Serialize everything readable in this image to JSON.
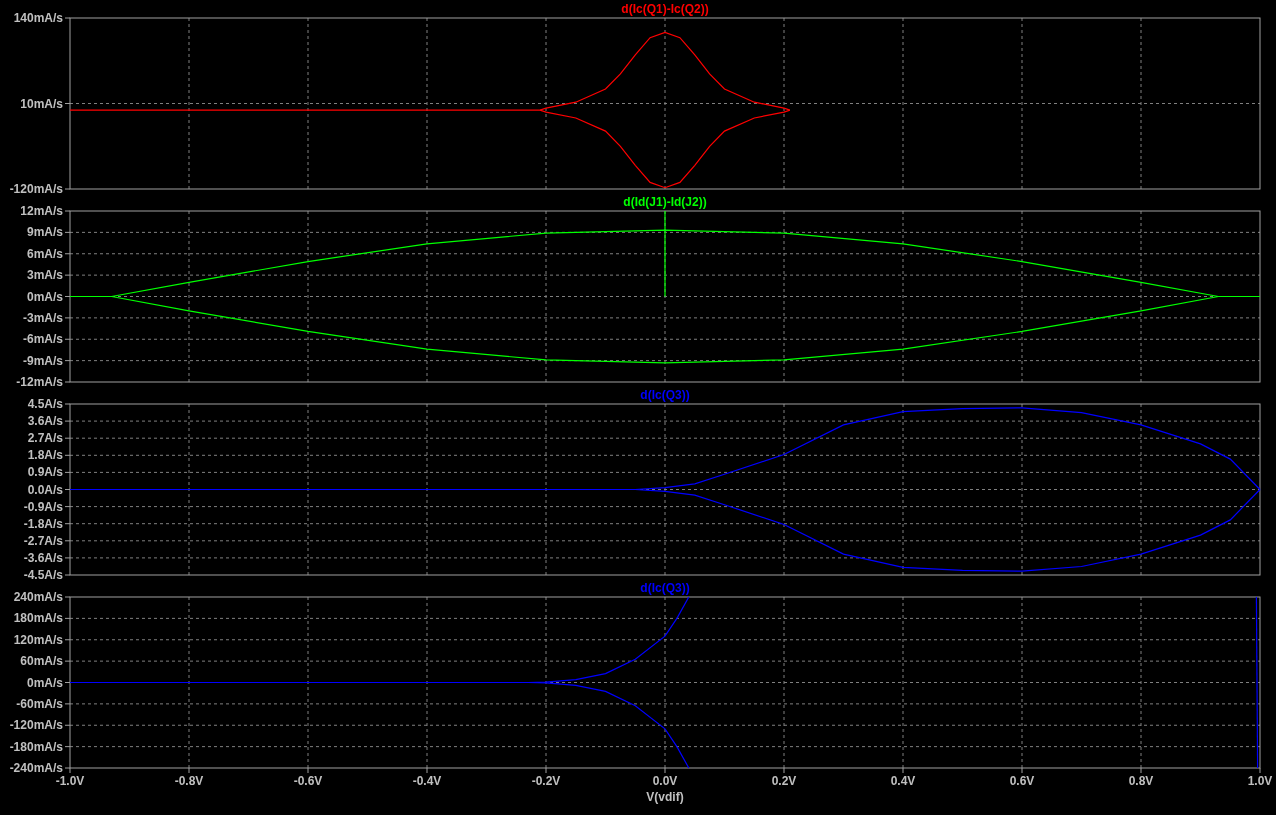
{
  "panes": [
    {
      "chart_data": {
        "type": "line",
        "grid": true,
        "title": "d(Ic(Q1)-Ic(Q2))",
        "xlim": [
          -1,
          1
        ],
        "ylim": [
          -120,
          140
        ],
        "yticks": [
          {
            "value": 140,
            "label": "140mA/s"
          },
          {
            "value": 10,
            "label": "10mA/s"
          },
          {
            "value": -120,
            "label": "-120mA/s"
          }
        ],
        "x": [
          -1,
          -0.5,
          -0.21,
          -0.2,
          -0.15,
          -0.1,
          -0.075,
          -0.05,
          -0.025,
          0,
          0.025,
          0.05,
          0.075,
          0.1,
          0.15,
          0.2,
          0.21
        ],
        "series": [
          {
            "color": "#ff0000",
            "values": [
              0,
              0,
              0,
              3,
              12,
              32,
              55,
              84,
              110,
              118,
              110,
              84,
              55,
              32,
              12,
              3,
              0
            ]
          },
          {
            "color": "#ff0000",
            "values": [
              null,
              null,
              0,
              -3,
              -12,
              -32,
              -55,
              -84,
              -110,
              -118,
              -110,
              -84,
              -55,
              -32,
              -12,
              -3,
              0
            ]
          }
        ]
      }
    },
    {
      "chart_data": {
        "type": "line",
        "grid": true,
        "title": "d(Id(J1)-Id(J2))",
        "xlim": [
          -1,
          1
        ],
        "ylim": [
          -12,
          12
        ],
        "yticks": [
          {
            "value": 12,
            "label": "12mA/s"
          },
          {
            "value": 9,
            "label": "9mA/s"
          },
          {
            "value": 6,
            "label": "6mA/s"
          },
          {
            "value": 3,
            "label": "3mA/s"
          },
          {
            "value": 0,
            "label": "0mA/s"
          },
          {
            "value": -3,
            "label": "-3mA/s"
          },
          {
            "value": -6,
            "label": "-6mA/s"
          },
          {
            "value": -9,
            "label": "-9mA/s"
          },
          {
            "value": -12,
            "label": "-12mA/s"
          }
        ],
        "x": [
          -1,
          -0.93,
          -0.8,
          -0.6,
          -0.4,
          -0.2,
          0,
          0,
          0.2,
          0.4,
          0.6,
          0.8,
          0.93,
          1
        ],
        "series": [
          {
            "color": "#00ff00",
            "values": [
              0,
              0,
              2,
              4.9,
              7.4,
              8.9,
              9.3,
              9.3,
              8.9,
              7.4,
              4.9,
              2,
              0,
              0
            ]
          },
          {
            "color": "#00ff00",
            "values": [
              null,
              0,
              -2,
              -4.9,
              -7.4,
              -8.9,
              -9.3,
              -9.3,
              -8.9,
              -7.4,
              -4.9,
              -2,
              0,
              null
            ]
          },
          {
            "color": "#00ff00",
            "values": [
              null,
              null,
              null,
              null,
              null,
              null,
              0,
              12,
              null,
              null,
              null,
              null,
              null,
              null
            ]
          }
        ]
      }
    },
    {
      "chart_data": {
        "type": "line",
        "grid": true,
        "title": "d(Ic(Q3))",
        "xlim": [
          -1,
          1
        ],
        "ylim": [
          -4.5,
          4.5
        ],
        "yticks": [
          {
            "value": 4.5,
            "label": "4.5A/s"
          },
          {
            "value": 3.6,
            "label": "3.6A/s"
          },
          {
            "value": 2.7,
            "label": "2.7A/s"
          },
          {
            "value": 1.8,
            "label": "1.8A/s"
          },
          {
            "value": 0.9,
            "label": "0.9A/s"
          },
          {
            "value": 0,
            "label": "0.0A/s"
          },
          {
            "value": -0.9,
            "label": "-0.9A/s"
          },
          {
            "value": -1.8,
            "label": "-1.8A/s"
          },
          {
            "value": -2.7,
            "label": "-2.7A/s"
          },
          {
            "value": -3.6,
            "label": "-3.6A/s"
          },
          {
            "value": -4.5,
            "label": "-4.5A/s"
          }
        ],
        "x": [
          -1,
          -0.5,
          -0.05,
          0,
          0.05,
          0.1,
          0.2,
          0.3,
          0.4,
          0.5,
          0.6,
          0.7,
          0.8,
          0.9,
          0.95,
          1
        ],
        "series": [
          {
            "color": "#0000ff",
            "values": [
              0,
              0,
              0,
              0.1,
              0.3,
              0.8,
              1.84,
              3.4,
              4.1,
              4.26,
              4.3,
              4.05,
              3.4,
              2.4,
              1.6,
              0
            ]
          },
          {
            "color": "#0000ff",
            "values": [
              null,
              null,
              0,
              -0.1,
              -0.3,
              -0.8,
              -1.84,
              -3.4,
              -4.1,
              -4.26,
              -4.3,
              -4.05,
              -3.4,
              -2.4,
              -1.6,
              0
            ]
          }
        ]
      }
    },
    {
      "chart_data": {
        "type": "line",
        "grid": true,
        "title": "d(Ic(Q3))",
        "xlabel": "V(vdif)",
        "xlim": [
          -1,
          1
        ],
        "ylim": [
          -240,
          240
        ],
        "xticks": [
          {
            "value": -1,
            "label": "-1.0V"
          },
          {
            "value": -0.8,
            "label": "-0.8V"
          },
          {
            "value": -0.6,
            "label": "-0.6V"
          },
          {
            "value": -0.4,
            "label": "-0.4V"
          },
          {
            "value": -0.2,
            "label": "-0.2V"
          },
          {
            "value": 0,
            "label": "0.0V"
          },
          {
            "value": 0.2,
            "label": "0.2V"
          },
          {
            "value": 0.4,
            "label": "0.4V"
          },
          {
            "value": 0.6,
            "label": "0.6V"
          },
          {
            "value": 0.8,
            "label": "0.8V"
          },
          {
            "value": 1,
            "label": "1.0V"
          }
        ],
        "yticks": [
          {
            "value": 240,
            "label": "240mA/s"
          },
          {
            "value": 180,
            "label": "180mA/s"
          },
          {
            "value": 120,
            "label": "120mA/s"
          },
          {
            "value": 60,
            "label": "60mA/s"
          },
          {
            "value": 0,
            "label": "0mA/s"
          },
          {
            "value": -60,
            "label": "-60mA/s"
          },
          {
            "value": -120,
            "label": "-120mA/s"
          },
          {
            "value": -180,
            "label": "-180mA/s"
          },
          {
            "value": -240,
            "label": "-240mA/s"
          }
        ],
        "x": [
          -1,
          -0.5,
          -0.23,
          -0.2,
          -0.15,
          -0.1,
          -0.05,
          0,
          0.02,
          0.04,
          0.994,
          0.996
        ],
        "series": [
          {
            "color": "#0000ff",
            "values": [
              0,
              0,
              0,
              1,
              8,
              25,
              65,
              130,
              180,
              240,
              null,
              null
            ]
          },
          {
            "color": "#0000ff",
            "values": [
              null,
              null,
              0,
              -1,
              -8,
              -25,
              -65,
              -130,
              -180,
              -240,
              null,
              null
            ]
          },
          {
            "color": "#0000ff",
            "values": [
              null,
              null,
              null,
              null,
              null,
              null,
              null,
              null,
              null,
              null,
              240,
              -240
            ]
          }
        ]
      }
    }
  ]
}
